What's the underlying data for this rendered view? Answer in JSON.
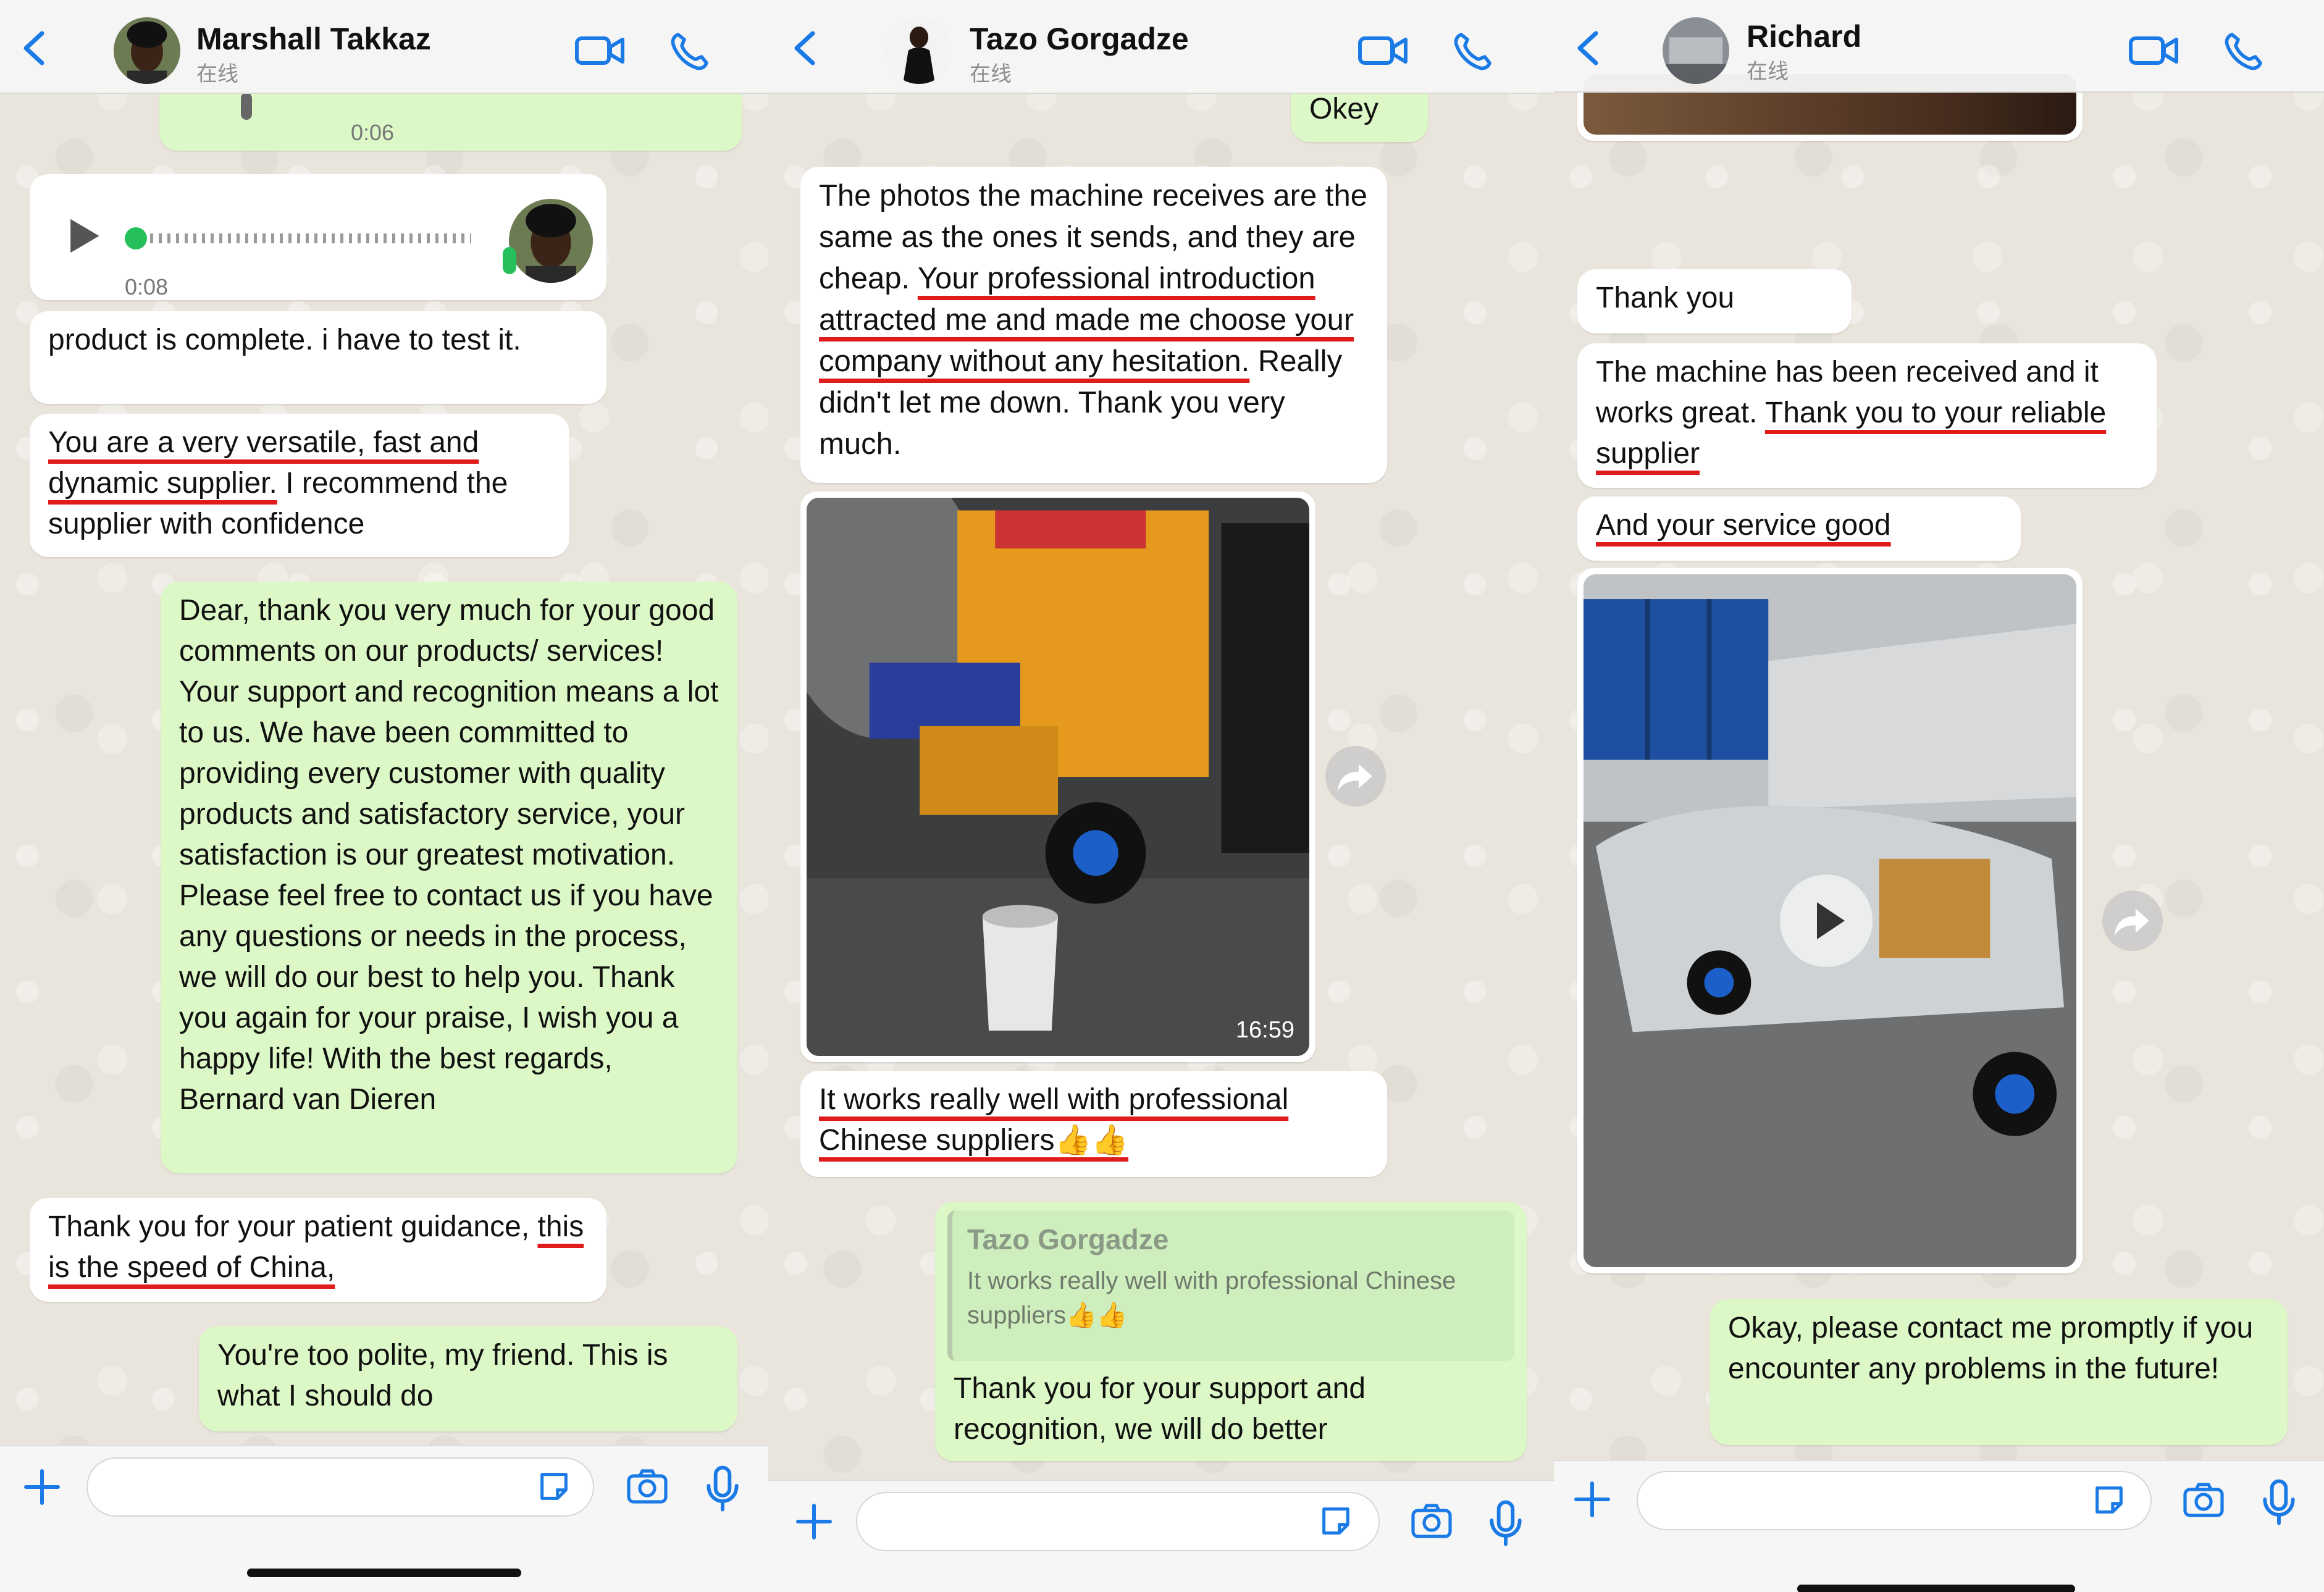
{
  "panel1": {
    "contact_name": "Marshall Takkaz",
    "status": "在线",
    "prev_voice_duration": "0:06",
    "voice_duration": "0:08",
    "messages": {
      "m1": "product is complete. i have to test it.",
      "m2_ul": "You are a very versatile, fast and dynamic supplier.",
      "m2_rest": " I recommend the supplier with confidence",
      "m3": "Dear, thank you very much for your good comments on our products/ services! Your support and recognition means a lot to us. We have been committed to providing every customer with quality products and satisfactory service, your satisfaction is our greatest motivation. Please feel free to contact us if you have any questions or needs in the process, we will do our best to help you. Thank you again for your praise, I wish you a happy life! With the best regards, Bernard van Dieren",
      "m4_a": "Thank you for your patient guidance, ",
      "m4_ul": "this is the speed of China,",
      "m5": "You're too polite, my friend. This is what I should do"
    }
  },
  "panel2": {
    "contact_name": "Tazo Gorgadze",
    "status": "在线",
    "messages": {
      "m0": "Okey",
      "m1_a": "The photos the machine receives are the same as the ones it sends, and they are cheap. ",
      "m1_ul": "Your professional introduction attracted me and made me choose your company without any hesitation.",
      "m1_b": " Really didn't let me down. Thank you very much.",
      "photo_time": "16:59",
      "m2_ul": "It works really well with professional Chinese suppliers👍👍",
      "reply_author": "Tazo Gorgadze",
      "reply_quote": "It works really well with professional Chinese suppliers👍👍",
      "m3": "Thank you for your support and recognition, we will do better"
    }
  },
  "panel3": {
    "contact_name": "Richard",
    "status": "在线",
    "messages": {
      "m1": "Thank you",
      "m2_a": "The machine has been received and it works great. ",
      "m2_ul": "Thank you to your reliable supplier",
      "m3_ul": "And your service good",
      "m4": "Okay, please contact me promptly if you encounter any problems in the future!"
    }
  },
  "colors": {
    "accent_blue": "#1a7ae6",
    "incoming_bubble": "#ffffff",
    "outgoing_bubble": "#dcf8c6",
    "underline_red": "#e01b1b",
    "voice_green": "#25c05a"
  },
  "icons": [
    "back-chevron-icon",
    "video-call-icon",
    "phone-call-icon",
    "plus-icon",
    "sticker-icon",
    "camera-icon",
    "microphone-icon",
    "play-icon",
    "forward-icon"
  ]
}
